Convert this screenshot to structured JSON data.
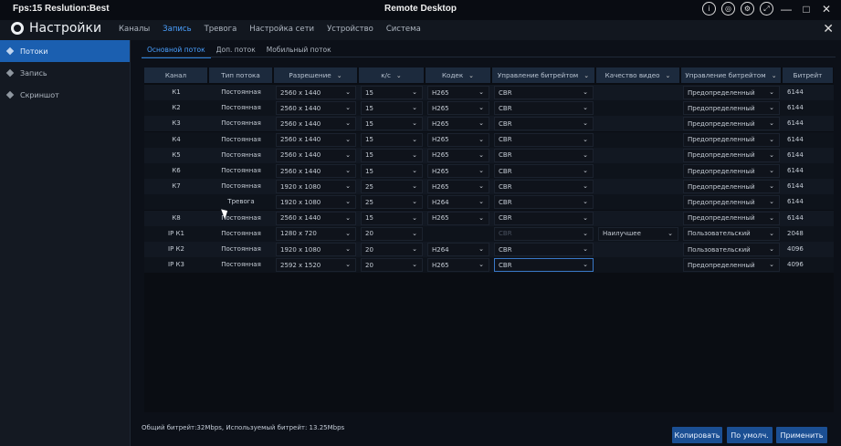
{
  "titlebar": {
    "fps": "Fps:15 Reslution:Best",
    "title": "Remote Desktop",
    "minimize": "—",
    "maximize": "□",
    "close": "✕"
  },
  "header": {
    "title": "Настройки",
    "nav": [
      "Каналы",
      "Запись",
      "Тревога",
      "Настройка сети",
      "Устройство",
      "Система"
    ],
    "active_nav": 1,
    "close": "✕"
  },
  "sidebar": {
    "items": [
      "Потоки",
      "Запись",
      "Скриншот"
    ],
    "active": 0
  },
  "subtabs": {
    "items": [
      "Основной поток",
      "Доп. поток",
      "Мобильный поток"
    ],
    "active": 0
  },
  "table": {
    "headers": [
      "Канал",
      "Тип потока",
      "Разрешение",
      "к/с",
      "Кодек",
      "Управление битрейтом",
      "Качество видео",
      "Управление битрейтом",
      "Битрейт"
    ],
    "rows": [
      [
        "К1",
        "Постоянная",
        "2560 x 1440",
        "15",
        "H265",
        "CBR",
        "",
        "Предопределенный",
        "6144"
      ],
      [
        "К2",
        "Постоянная",
        "2560 x 1440",
        "15",
        "H265",
        "CBR",
        "",
        "Предопределенный",
        "6144"
      ],
      [
        "К3",
        "Постоянная",
        "2560 x 1440",
        "15",
        "H265",
        "CBR",
        "",
        "Предопределенный",
        "6144"
      ],
      [
        "К4",
        "Постоянная",
        "2560 x 1440",
        "15",
        "H265",
        "CBR",
        "",
        "Предопределенный",
        "6144"
      ],
      [
        "К5",
        "Постоянная",
        "2560 x 1440",
        "15",
        "H265",
        "CBR",
        "",
        "Предопределенный",
        "6144"
      ],
      [
        "К6",
        "Постоянная",
        "2560 x 1440",
        "15",
        "H265",
        "CBR",
        "",
        "Предопределенный",
        "6144"
      ],
      [
        "К7",
        "Постоянная",
        "1920 x 1080",
        "25",
        "H265",
        "CBR",
        "",
        "Предопределенный",
        "6144"
      ],
      [
        "",
        "Тревога",
        "1920 x 1080",
        "25",
        "H264",
        "CBR",
        "",
        "Предопределенный",
        "6144"
      ],
      [
        "К8",
        "Постоянная",
        "2560 x 1440",
        "15",
        "H265",
        "CBR",
        "",
        "Предопределенный",
        "6144"
      ],
      [
        "IP К1",
        "Постоянная",
        "1280 x 720",
        "20",
        "",
        "CBR",
        "Наилучшее",
        "Пользовательский",
        "2048"
      ],
      [
        "IP К2",
        "Постоянная",
        "1920 x 1080",
        "20",
        "H264",
        "CBR",
        "",
        "Пользовательский",
        "4096"
      ],
      [
        "IP К3",
        "Постоянная",
        "2592 x 1520",
        "20",
        "H265",
        "CBR",
        "",
        "Предопределенный",
        "4096"
      ]
    ]
  },
  "footer": {
    "text": "Общий битрейт:32Mbps, Используемый битрейт: 13.25Mbps"
  },
  "buttons": {
    "copy": "Копировать",
    "default": "По умолч.",
    "apply": "Применить"
  }
}
